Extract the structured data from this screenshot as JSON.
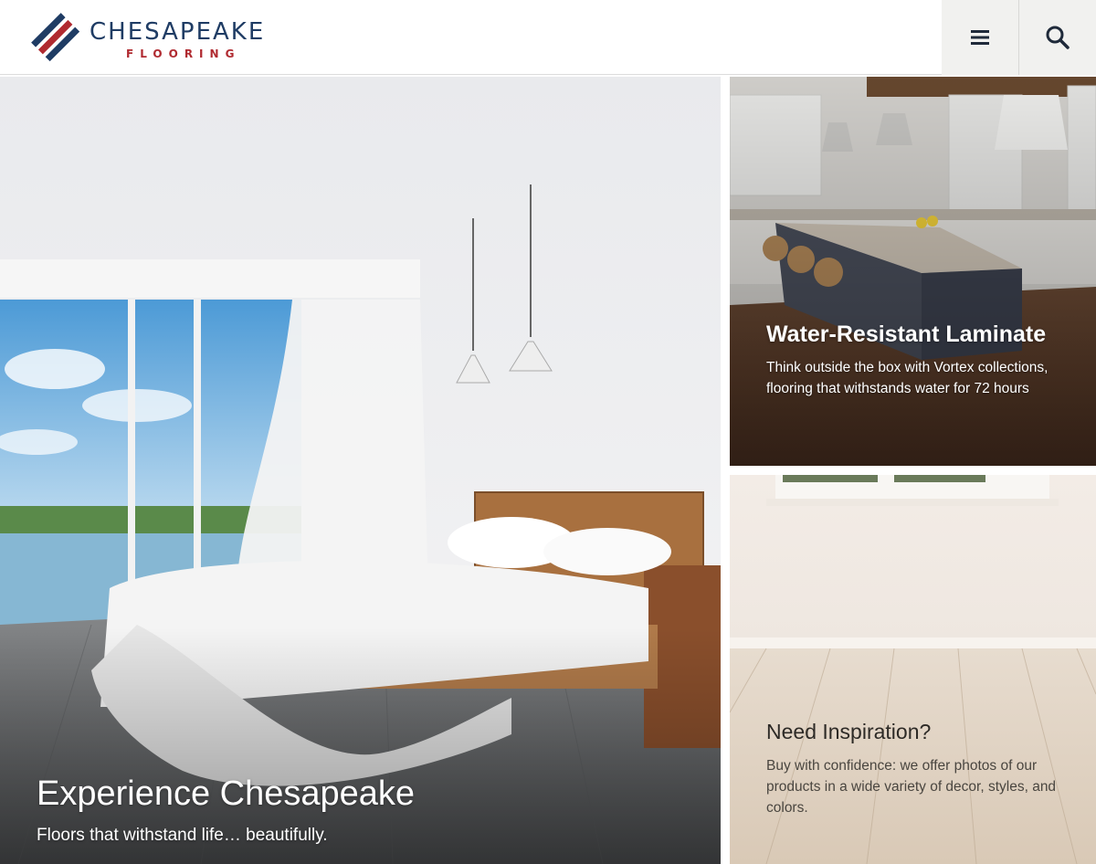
{
  "brand": {
    "name": "CHESAPEAKE",
    "sub": "FLOORING",
    "colors": {
      "navy": "#1f3c64",
      "red": "#b02a30"
    }
  },
  "header": {
    "menu_icon": "hamburger-menu-icon",
    "search_icon": "search-icon"
  },
  "hero": {
    "title": "Experience Chesapeake",
    "subtitle": "Floors that withstand life… beautifully."
  },
  "cards": [
    {
      "title": "Water-Resistant Laminate",
      "body": "Think outside the box with Vortex collections, flooring that withstands water for 72 hours"
    },
    {
      "title": "Need Inspiration?",
      "body": "Buy with confidence: we offer photos of our products in a wide variety of decor, styles, and colors."
    }
  ]
}
